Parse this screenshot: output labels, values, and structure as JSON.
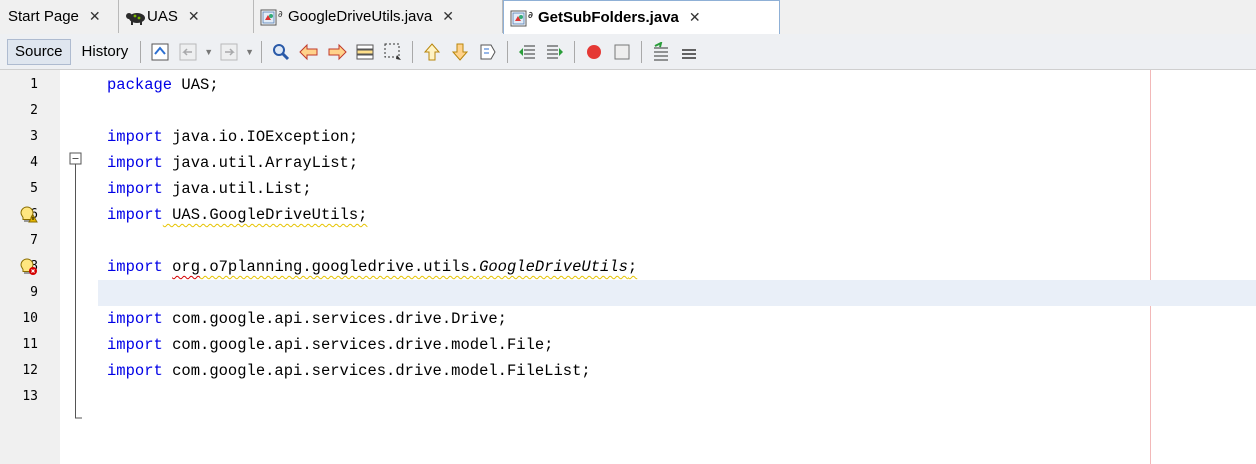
{
  "tabs": [
    {
      "label": "Start Page",
      "close": "✕",
      "icon": "none"
    },
    {
      "label": "UAS",
      "close": "✕",
      "icon": "project-icon"
    },
    {
      "label": "GoogleDriveUtils.java",
      "close": "✕",
      "icon": "java-file-icon"
    },
    {
      "label": "GetSubFolders.java",
      "close": "✕",
      "icon": "java-file-icon",
      "active": true
    }
  ],
  "toolbar": {
    "source_label": "Source",
    "history_label": "History",
    "icons": [
      "last-edit-icon",
      "back-icon",
      "forward-icon",
      "find-selection-icon",
      "find-previous-icon",
      "find-next-icon",
      "toggle-highlight-icon",
      "toggle-rect-selection-icon",
      "previous-bookmark-icon",
      "next-bookmark-icon",
      "toggle-bookmark-icon",
      "shift-left-icon",
      "shift-right-icon",
      "start-macro-icon",
      "stop-macro-icon",
      "comment-icon",
      "uncomment-icon"
    ]
  },
  "editor": {
    "lines": [
      {
        "n": "1",
        "parts": [
          [
            "package",
            "kw"
          ],
          [
            " UAS;",
            ""
          ]
        ]
      },
      {
        "n": "2",
        "parts": []
      },
      {
        "n": "3",
        "parts": [
          [
            "import",
            "kw"
          ],
          [
            " java.io.IOException;",
            ""
          ]
        ]
      },
      {
        "n": "4",
        "parts": [
          [
            "import",
            "kw"
          ],
          [
            " java.util.ArrayList;",
            ""
          ]
        ]
      },
      {
        "n": "5",
        "parts": [
          [
            "import",
            "kw"
          ],
          [
            " java.util.List;",
            ""
          ]
        ]
      },
      {
        "n": "6",
        "parts": [
          [
            "import",
            "kw"
          ],
          [
            " UAS.GoogleDriveUtils;",
            "warn"
          ]
        ],
        "badge": "warning"
      },
      {
        "n": "7",
        "parts": []
      },
      {
        "n": "8",
        "parts": [
          [
            "import",
            "kw"
          ],
          [
            " ",
            ""
          ],
          [
            "org",
            "err"
          ],
          [
            ".o7planning.googledrive.utils.",
            "warn"
          ],
          [
            "GoogleDriveUtils",
            "warn-it"
          ],
          [
            ";",
            "warn"
          ]
        ],
        "badge": "error"
      },
      {
        "n": "9",
        "parts": [],
        "highlight": true
      },
      {
        "n": "10",
        "parts": [
          [
            "import",
            "kw"
          ],
          [
            " com.google.api.services.drive.Drive;",
            ""
          ]
        ]
      },
      {
        "n": "11",
        "parts": [
          [
            "import",
            "kw"
          ],
          [
            " com.google.api.services.drive.model.File;",
            ""
          ]
        ]
      },
      {
        "n": "12",
        "parts": [
          [
            "import",
            "kw"
          ],
          [
            " com.google.api.services.drive.model.FileList;",
            ""
          ]
        ]
      },
      {
        "n": "13",
        "parts": []
      }
    ]
  }
}
